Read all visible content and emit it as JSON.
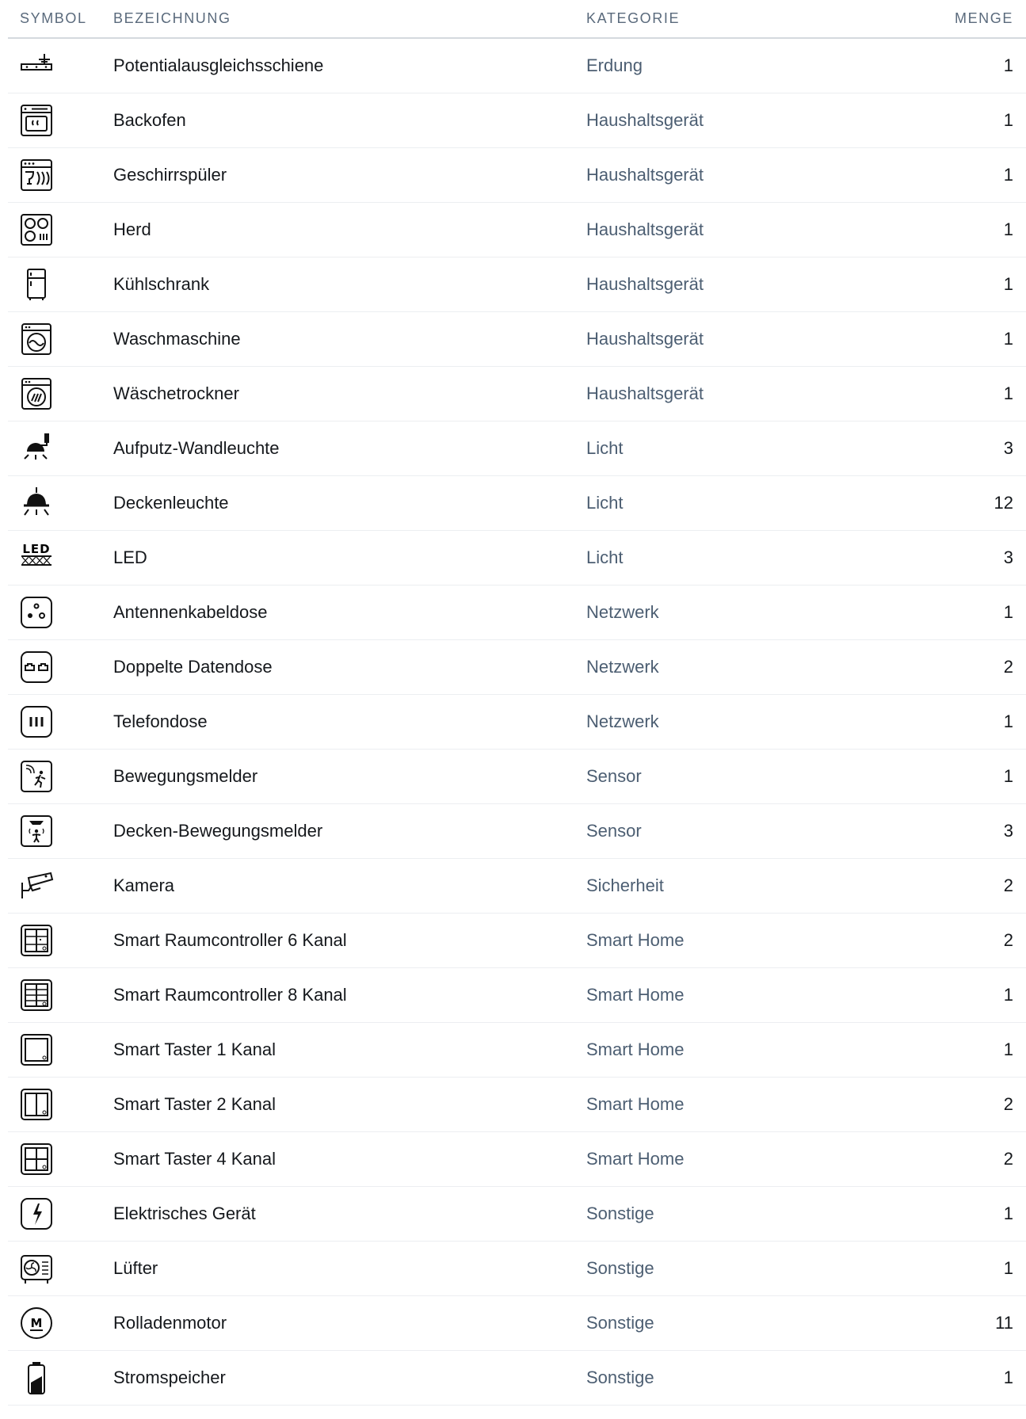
{
  "table": {
    "headers": {
      "symbol": "SYMBOL",
      "name": "BEZEICHNUNG",
      "category": "KATEGORIE",
      "quantity": "MENGE"
    },
    "rows": [
      {
        "icon": "equipotential-bar-icon",
        "name": "Potentialausgleichsschiene",
        "category": "Erdung",
        "quantity": "1"
      },
      {
        "icon": "oven-icon",
        "name": "Backofen",
        "category": "Haushaltsgerät",
        "quantity": "1"
      },
      {
        "icon": "dishwasher-icon",
        "name": "Geschirrspüler",
        "category": "Haushaltsgerät",
        "quantity": "1"
      },
      {
        "icon": "stove-icon",
        "name": "Herd",
        "category": "Haushaltsgerät",
        "quantity": "1"
      },
      {
        "icon": "fridge-icon",
        "name": "Kühlschrank",
        "category": "Haushaltsgerät",
        "quantity": "1"
      },
      {
        "icon": "washing-machine-icon",
        "name": "Waschmaschine",
        "category": "Haushaltsgerät",
        "quantity": "1"
      },
      {
        "icon": "dryer-icon",
        "name": "Wäschetrockner",
        "category": "Haushaltsgerät",
        "quantity": "1"
      },
      {
        "icon": "wall-light-icon",
        "name": "Aufputz-Wandleuchte",
        "category": "Licht",
        "quantity": "3"
      },
      {
        "icon": "ceiling-light-icon",
        "name": "Deckenleuchte",
        "category": "Licht",
        "quantity": "12"
      },
      {
        "icon": "led-icon",
        "name": "LED",
        "category": "Licht",
        "quantity": "3",
        "icon_text": "LED"
      },
      {
        "icon": "antenna-socket-icon",
        "name": "Antennenkabeldose",
        "category": "Netzwerk",
        "quantity": "1"
      },
      {
        "icon": "double-data-socket-icon",
        "name": "Doppelte Datendose",
        "category": "Netzwerk",
        "quantity": "2"
      },
      {
        "icon": "phone-socket-icon",
        "name": "Telefondose",
        "category": "Netzwerk",
        "quantity": "1"
      },
      {
        "icon": "motion-sensor-icon",
        "name": "Bewegungsmelder",
        "category": "Sensor",
        "quantity": "1"
      },
      {
        "icon": "ceiling-motion-sensor-icon",
        "name": "Decken-Bewegungsmelder",
        "category": "Sensor",
        "quantity": "3"
      },
      {
        "icon": "camera-icon",
        "name": "Kamera",
        "category": "Sicherheit",
        "quantity": "2"
      },
      {
        "icon": "room-controller-6-icon",
        "name": "Smart Raumcontroller 6 Kanal",
        "category": "Smart Home",
        "quantity": "2"
      },
      {
        "icon": "room-controller-8-icon",
        "name": "Smart Raumcontroller 8 Kanal",
        "category": "Smart Home",
        "quantity": "1"
      },
      {
        "icon": "button-1-channel-icon",
        "name": "Smart Taster 1 Kanal",
        "category": "Smart Home",
        "quantity": "1"
      },
      {
        "icon": "button-2-channel-icon",
        "name": "Smart Taster 2 Kanal",
        "category": "Smart Home",
        "quantity": "2"
      },
      {
        "icon": "button-4-channel-icon",
        "name": "Smart Taster 4 Kanal",
        "category": "Smart Home",
        "quantity": "2"
      },
      {
        "icon": "electrical-device-icon",
        "name": "Elektrisches Gerät",
        "category": "Sonstige",
        "quantity": "1"
      },
      {
        "icon": "fan-icon",
        "name": "Lüfter",
        "category": "Sonstige",
        "quantity": "1"
      },
      {
        "icon": "shutter-motor-icon",
        "name": "Rolladenmotor",
        "category": "Sonstige",
        "quantity": "11",
        "icon_text": "M"
      },
      {
        "icon": "battery-storage-icon",
        "name": "Stromspeicher",
        "category": "Sonstige",
        "quantity": "1"
      }
    ]
  }
}
